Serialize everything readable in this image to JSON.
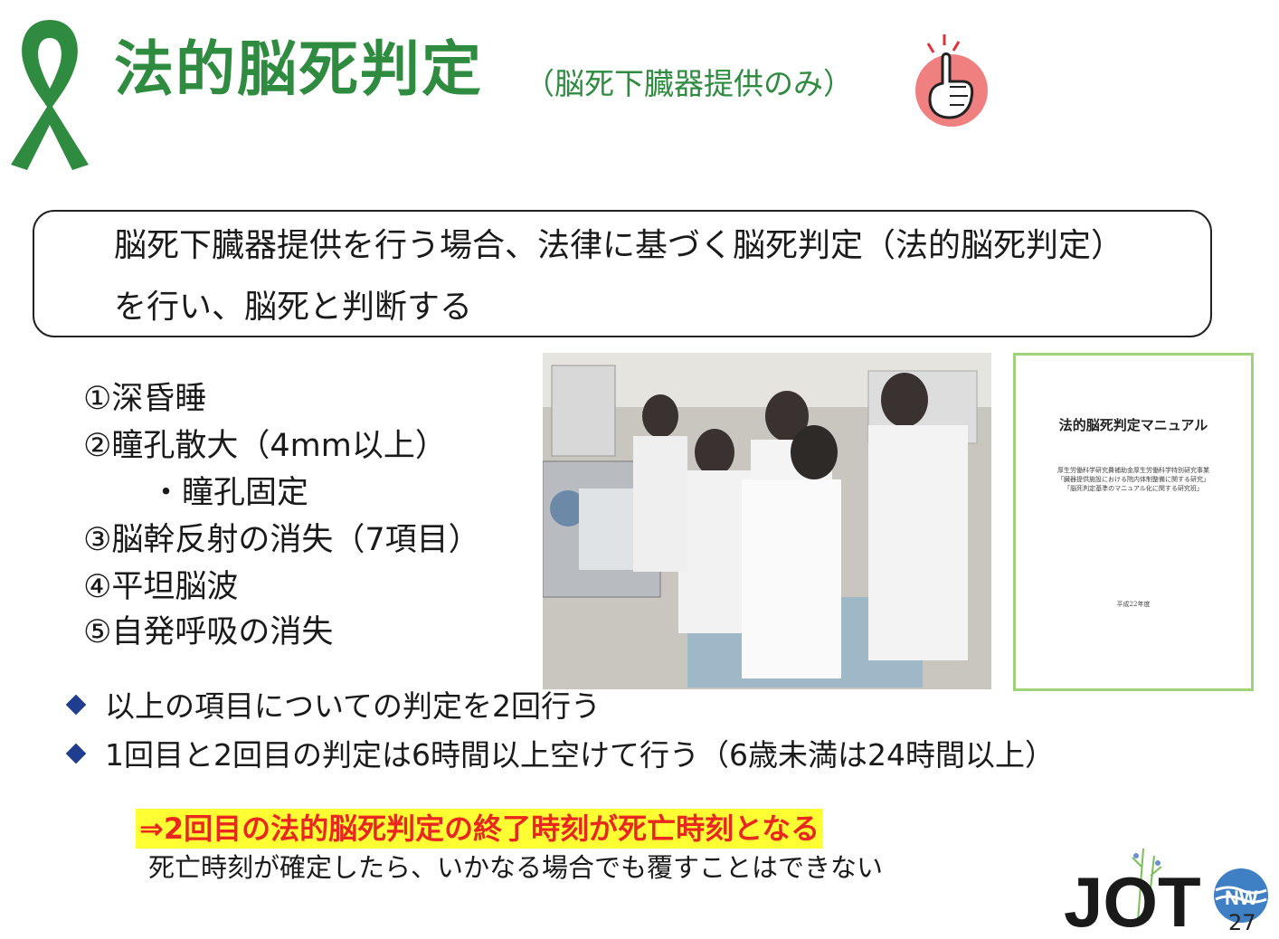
{
  "header": {
    "title": "法的脳死判定",
    "subtitle": "（脳死下臓器提供のみ）"
  },
  "definition": {
    "line1": "脳死下臓器提供を行う場合、法律に基づく脳死判定（法的脳死判定）",
    "line2": "を行い、脳死と判断する"
  },
  "criteria": [
    "①深昏睡",
    "②瞳孔散大（4mm以上）",
    "・瞳孔固定",
    "③脳幹反射の消失（7項目）",
    "④平坦脳波",
    "⑤自発呼吸の消失"
  ],
  "manual": {
    "title": "法的脳死判定マニュアル",
    "lines": [
      "厚生労働科学研究費補助金厚生労働科学特別研究事業",
      "「臓器提供施設における院内体制整備に関する研究」",
      "「脳死判定基準のマニュアル化に関する研究班」"
    ],
    "date": "平成22年度"
  },
  "bullets": [
    "以上の項目についての判定を2回行う",
    "1回目と2回目の判定は6時間以上空けて行う（6歳未満は24時間以上）"
  ],
  "conclusion": "⇒2回目の法的脳死判定の終了時刻が死亡時刻となる",
  "note": "死亡時刻が確定したら、いかなる場合でも覆すことはできない",
  "logo": {
    "text": "JOT",
    "badge": "NW"
  },
  "page_number": "27",
  "colors": {
    "title_green": "#2e8b3f",
    "highlight": "#ffff33",
    "emphasis_red": "#e8281e",
    "bullet_blue": "#1f3e8f"
  }
}
